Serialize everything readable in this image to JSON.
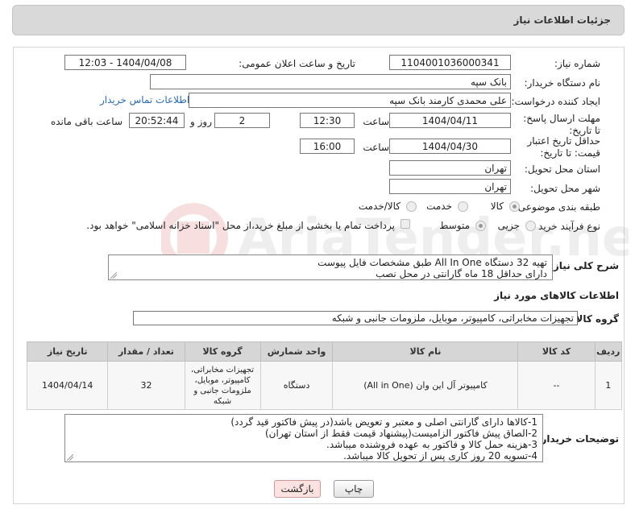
{
  "header": {
    "title": "جزئیات اطلاعات نیاز"
  },
  "fields": {
    "need_number_label": "شماره نیاز:",
    "need_number": "1104001036000341",
    "announce_label": "تاریخ و ساعت اعلان عمومی:",
    "announce_value": "1404/04/08 - 12:03",
    "buyer_org_label": "نام دستگاه خریدار:",
    "buyer_org": "بانک سپه",
    "creator_label": "ایجاد کننده درخواست:",
    "creator": "علی محمدی کارمند بانک سپه",
    "contact_link": "اطلاعات تماس خریدار",
    "deadline_label": "مهلت ارسال پاسخ: تا تاریخ:",
    "deadline_date": "1404/04/11",
    "time_label": "ساعت",
    "deadline_time": "12:30",
    "days_value": "2",
    "days_label": "روز و",
    "remaining_time": "20:52:44",
    "remaining_label": "ساعت باقی مانده",
    "validity_label": "حداقل تاریخ اعتبار قیمت: تا تاریخ:",
    "validity_date": "1404/04/30",
    "validity_time": "16:00",
    "province_label": "استان محل تحویل:",
    "province": "تهران",
    "city_label": "شهر محل تحویل:",
    "city": "تهران",
    "category_label": "طبقه بندی موضوعی:",
    "category_options": [
      "کالا",
      "خدمت",
      "کالا/خدمت"
    ],
    "process_label": "نوع فرآیند خرید :",
    "process_options": [
      "جزیی",
      "متوسط"
    ],
    "payment_note": "پرداخت تمام یا بخشی از مبلغ خرید،از محل \"اسناد خزانه اسلامی\" خواهد بود."
  },
  "summary": {
    "label": "شرح کلی نیاز:",
    "line1": "تهیه 32 دستگاه All In One طبق مشخصات فایل پیوست",
    "line2": "دارای حداقل 18 ماه گارانتی در محل نصب"
  },
  "goods": {
    "section_title": "اطلاعات کالاهای مورد نیاز",
    "group_label": "گروه کالا:",
    "group_value": "تجهیزات مخابراتی، کامپیوتر، موبایل، ملزومات جانبی و شبکه",
    "columns": [
      "ردیف",
      "کد کالا",
      "نام کالا",
      "واحد شمارش",
      "گروه کالا",
      "تعداد / مقدار",
      "تاریخ نیاز"
    ],
    "rows": [
      {
        "row": "1",
        "code": "--",
        "name": "کامپیوتر آل این وان (All in One)",
        "unit": "دستگاه",
        "group": "تجهیزات مخابراتی، کامپیوتر، موبایل، ملزومات جانبی و شبکه",
        "qty": "32",
        "date": "1404/04/14"
      }
    ]
  },
  "buyer_notes": {
    "label": "توضیحات خریدار:",
    "lines": [
      "1-کالاها دارای گارانتی اصلی و  معتبر و تعویض باشد(در پیش فاکتور قید گردد)",
      "2-الصاق پیش فاکتور الزامیست(پیشنهاد قیمت فقط از استان تهران)",
      "3-هزینه حمل کالا و فاکتور به عهده فروشنده میباشد.",
      "4-تسویه 20 روز کاری پس از تحویل کالا میباشد."
    ]
  },
  "buttons": {
    "print": "چاپ",
    "back": "بازگشت"
  },
  "colors": {
    "link": "#2b6cb0",
    "header_bg": "#d9d9d9",
    "back_button_bg": "#fde2e2"
  }
}
